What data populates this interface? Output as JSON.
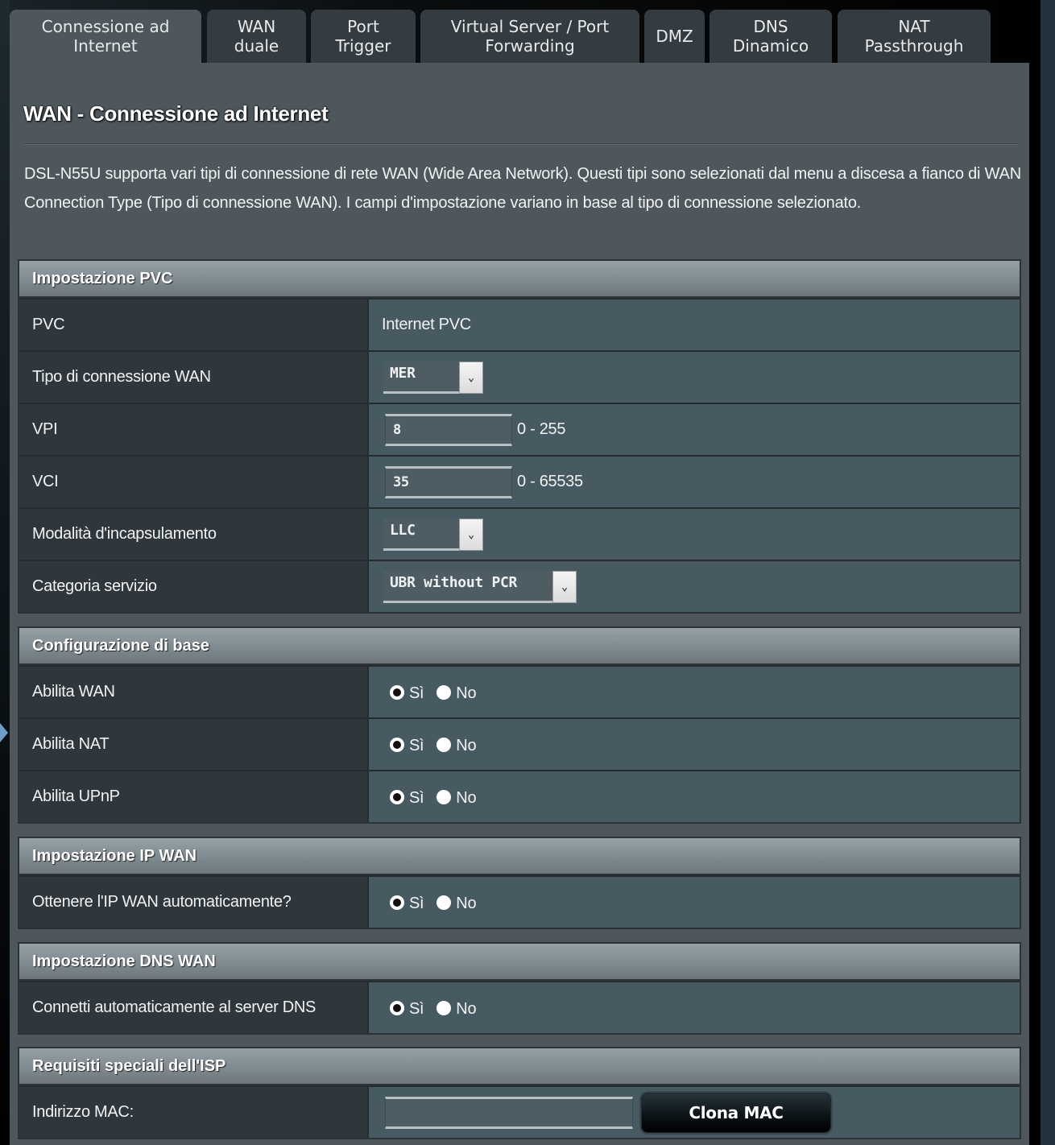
{
  "tabs": [
    {
      "label": "Connessione ad\nInternet",
      "active": true
    },
    {
      "label": "WAN\nduale",
      "active": false
    },
    {
      "label": "Port\nTrigger",
      "active": false
    },
    {
      "label": "Virtual Server / Port\nForwarding",
      "active": false
    },
    {
      "label": "DMZ",
      "active": false
    },
    {
      "label": "DNS\nDinamico",
      "active": false
    },
    {
      "label": "NAT\nPassthrough",
      "active": false
    }
  ],
  "page": {
    "title": "WAN - Connessione ad Internet",
    "description": "DSL-N55U supporta vari tipi di connessione di rete WAN (Wide Area Network). Questi tipi sono selezionati dal menu a discesa a fianco di WAN Connection Type (Tipo di connessione WAN). I campi d'impostazione variano in base al tipo di connessione selezionato."
  },
  "pvc": {
    "header": "Impostazione PVC",
    "pvc_label": "PVC",
    "pvc_value": "Internet PVC",
    "wan_type_label": "Tipo di connessione WAN",
    "wan_type_value": "MER",
    "vpi_label": "VPI",
    "vpi_value": "8",
    "vpi_range": "0 - 255",
    "vci_label": "VCI",
    "vci_value": "35",
    "vci_range": "0 - 65535",
    "encap_label": "Modalità d'incapsulamento",
    "encap_value": "LLC",
    "service_label": "Categoria servizio",
    "service_value": "UBR without PCR"
  },
  "radio": {
    "yes": "Sì",
    "no": "No"
  },
  "basic": {
    "header": "Configurazione di base",
    "rows": [
      {
        "label": "Abilita WAN",
        "value": "yes"
      },
      {
        "label": "Abilita NAT",
        "value": "yes"
      },
      {
        "label": "Abilita UPnP",
        "value": "yes"
      }
    ]
  },
  "ipwan": {
    "header": "Impostazione IP WAN",
    "auto_ip_label": "Ottenere l'IP WAN automaticamente?",
    "auto_ip_value": "yes"
  },
  "dnswan": {
    "header": "Impostazione DNS WAN",
    "auto_dns_label": "Connetti automaticamente al server DNS",
    "auto_dns_value": "yes"
  },
  "isp": {
    "header": "Requisiti speciali dell'ISP",
    "mac_label": "Indirizzo MAC:",
    "mac_value": "",
    "clone_button": "Clona MAC"
  }
}
